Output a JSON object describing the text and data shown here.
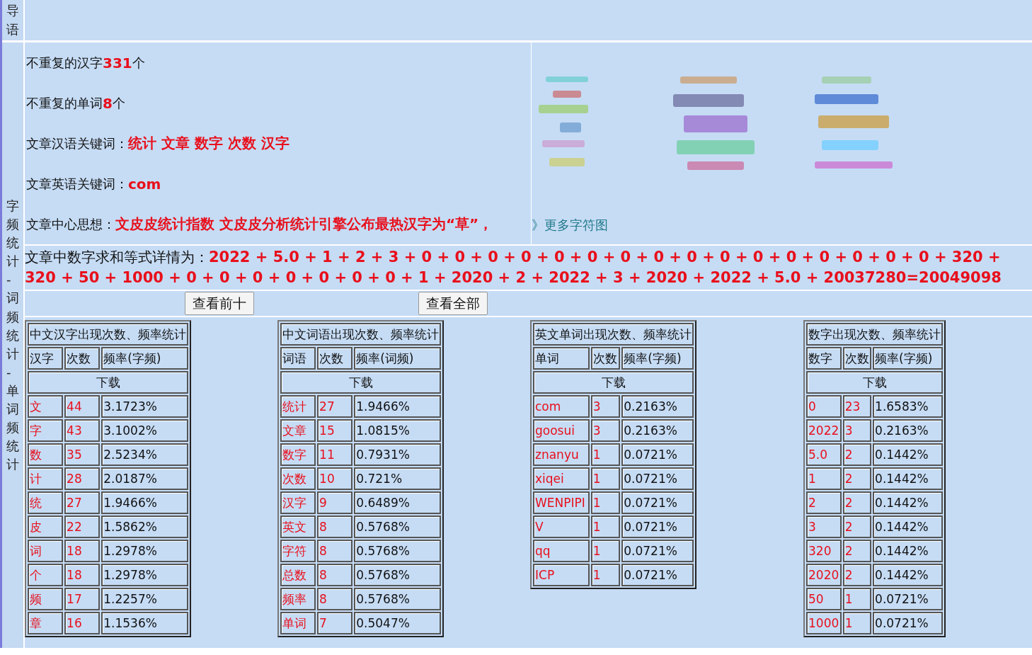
{
  "intro_label": "导语",
  "side_label": "字频统计-词频统计-单词频统计",
  "summary_lines": [
    "不重复的汉字**331**个",
    "不重复的单词**8**个",
    "文章汉语关键词：**统计 文章 数字 次数 汉字**",
    "文章英语关键词：**com**",
    "文章中心思想：**文皮皮统计指数 文皮皮分析统计引擎公布最热汉字为“草”，**"
  ],
  "wordcloud": {
    "kind": "picture",
    "more_link": "》更多字符图"
  },
  "number_sum": "文章中数字求和等式详情为：**2022 + 5.0 + 1 + 2 + 3 + 0 + 0 + 0 + 0 + 0 + 0 + 0 + 0 + 0 + 0 + 0 + 0 + 0 + 0 + 0 + 0 + 320 + 320 + 50 + 1000 + 0 + 0 + 0 + 0 + 0 + 0 + 0 + 1 + 2020 + 2 + 2022 + 3 + 2020 + 2022 + 5.0 + 20037280=20049098**",
  "buttons": [
    "查看前十",
    "查看全部"
  ],
  "tables": [
    {
      "title": "中文汉字出现次数、频率统计",
      "columns": [
        "汉字",
        "次数",
        "频率(字频)"
      ],
      "download": "下载",
      "rows": [
        [
          "文",
          "44",
          "3.1723%"
        ],
        [
          "字",
          "43",
          "3.1002%"
        ],
        [
          "数",
          "35",
          "2.5234%"
        ],
        [
          "计",
          "28",
          "2.0187%"
        ],
        [
          "统",
          "27",
          "1.9466%"
        ],
        [
          "皮",
          "22",
          "1.5862%"
        ],
        [
          "词",
          "18",
          "1.2978%"
        ],
        [
          "个",
          "18",
          "1.2978%"
        ],
        [
          "频",
          "17",
          "1.2257%"
        ],
        [
          "章",
          "16",
          "1.1536%"
        ]
      ]
    },
    {
      "title": "中文词语出现次数、频率统计",
      "columns": [
        "词语",
        "次数",
        "频率(词频)"
      ],
      "download": "下载",
      "rows": [
        [
          "统计",
          "27",
          "1.9466%"
        ],
        [
          "文章",
          "15",
          "1.0815%"
        ],
        [
          "数字",
          "11",
          "0.7931%"
        ],
        [
          "次数",
          "10",
          "0.721%"
        ],
        [
          "汉字",
          "9",
          "0.6489%"
        ],
        [
          "英文",
          "8",
          "0.5768%"
        ],
        [
          "字符",
          "8",
          "0.5768%"
        ],
        [
          "总数",
          "8",
          "0.5768%"
        ],
        [
          "频率",
          "8",
          "0.5768%"
        ],
        [
          "单词",
          "7",
          "0.5047%"
        ]
      ]
    },
    {
      "title": "英文单词出现次数、频率统计",
      "columns": [
        "单词",
        "次数",
        "频率(字频)"
      ],
      "download": "下载",
      "rows": [
        [
          "com",
          "3",
          "0.2163%"
        ],
        [
          "goosui",
          "3",
          "0.2163%"
        ],
        [
          "znanyu",
          "1",
          "0.0721%"
        ],
        [
          "xiqei",
          "1",
          "0.0721%"
        ],
        [
          "WENPIPI",
          "1",
          "0.0721%"
        ],
        [
          "V",
          "1",
          "0.0721%"
        ],
        [
          "qq",
          "1",
          "0.0721%"
        ],
        [
          "ICP",
          "1",
          "0.0721%"
        ]
      ]
    },
    {
      "title": "数字出现次数、频率统计",
      "columns": [
        "数字",
        "次数",
        "频率(字频)"
      ],
      "download": "下载",
      "rows": [
        [
          "0",
          "23",
          "1.6583%"
        ],
        [
          "2022",
          "3",
          "0.2163%"
        ],
        [
          "5.0",
          "2",
          "0.1442%"
        ],
        [
          "1",
          "2",
          "0.1442%"
        ],
        [
          "2",
          "2",
          "0.1442%"
        ],
        [
          "3",
          "2",
          "0.1442%"
        ],
        [
          "320",
          "2",
          "0.1442%"
        ],
        [
          "2020",
          "2",
          "0.1442%"
        ],
        [
          "50",
          "1",
          "0.0721%"
        ],
        [
          "1000",
          "1",
          "0.0721%"
        ]
      ]
    }
  ]
}
